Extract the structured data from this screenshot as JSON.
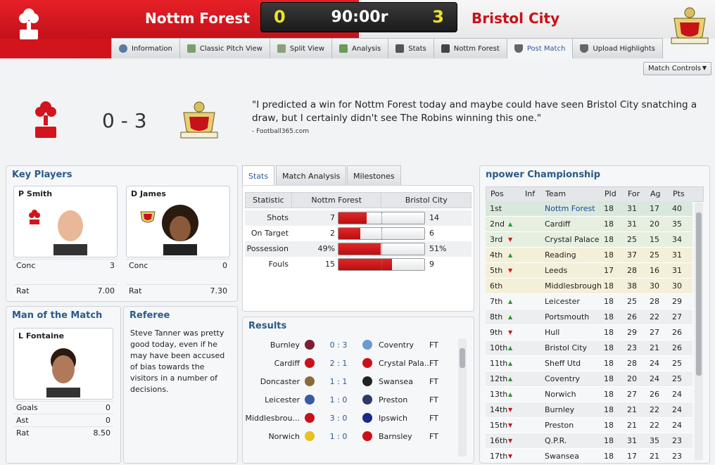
{
  "header": {
    "home_team": "Nottm Forest",
    "away_team": "Bristol City",
    "home_score": "0",
    "away_score": "3",
    "clock": "90:00r"
  },
  "tabs": [
    {
      "label": "Information",
      "icon": "info-icon"
    },
    {
      "label": "Classic Pitch View",
      "icon": "pitch-icon"
    },
    {
      "label": "Split View",
      "icon": "split-icon"
    },
    {
      "label": "Analysis",
      "icon": "analysis-icon"
    },
    {
      "label": "Stats",
      "icon": "stats-icon"
    },
    {
      "label": "Nottm Forest",
      "icon": "team-icon"
    },
    {
      "label": "Post Match",
      "icon": "shield-icon",
      "active": true
    },
    {
      "label": "Upload Highlights",
      "icon": "shield-icon"
    }
  ],
  "match_controls": "Match Controls",
  "summary": {
    "score": "0 - 3",
    "quote": "\"I predicted a win for Nottm Forest today and maybe could have seen Bristol City snatching a draw, but I certainly didn't see The Robins winning this one.\"",
    "source": "- Football365.com"
  },
  "key_players": {
    "title": "Key Players",
    "players": [
      {
        "name": "P Smith",
        "stat1_label": "Conc",
        "stat1": "3",
        "rat_label": "Rat",
        "rat": "7.00"
      },
      {
        "name": "D James",
        "stat1_label": "Conc",
        "stat1": "0",
        "rat_label": "Rat",
        "rat": "7.30"
      }
    ]
  },
  "motm": {
    "title": "Man of the Match",
    "name": "L Fontaine",
    "rows": [
      {
        "label": "Goals",
        "value": "0"
      },
      {
        "label": "Ast",
        "value": "0"
      },
      {
        "label": "Rat",
        "value": "8.50"
      }
    ]
  },
  "referee": {
    "title": "Referee",
    "text": "Steve Tanner was pretty good today, even if he may have been accused of bias towards the visitors in a number of decisions."
  },
  "stats_tabs": [
    "Stats",
    "Match Analysis",
    "Milestones"
  ],
  "stats": {
    "headers": [
      "Statistic",
      "Nottm Forest",
      "Bristol City"
    ],
    "rows": [
      {
        "label": "Shots",
        "home": "7",
        "away": "14",
        "fill": 0.33
      },
      {
        "label": "On Target",
        "home": "2",
        "away": "6",
        "fill": 0.25
      },
      {
        "label": "Possession",
        "home": "49%",
        "away": "51%",
        "fill": 0.49
      },
      {
        "label": "Fouls",
        "home": "15",
        "away": "9",
        "fill": 0.62
      }
    ]
  },
  "results": {
    "title": "Results",
    "rows": [
      {
        "home": "Burnley",
        "score": "0 : 3",
        "away": "Coventry",
        "status": "FT"
      },
      {
        "home": "Cardiff",
        "score": "2 : 1",
        "away": "Crystal Pala...",
        "status": "FT"
      },
      {
        "home": "Doncaster",
        "score": "1 : 1",
        "away": "Swansea",
        "status": "FT"
      },
      {
        "home": "Leicester",
        "score": "1 : 0",
        "away": "Preston",
        "status": "FT"
      },
      {
        "home": "Middlesbrou...",
        "score": "3 : 0",
        "away": "Ipswich",
        "status": "FT"
      },
      {
        "home": "Norwich",
        "score": "1 : 0",
        "away": "Barnsley",
        "status": "FT"
      }
    ]
  },
  "league": {
    "title": "npower Championship",
    "headers": [
      "Pos",
      "Inf",
      "Team",
      "Pld",
      "For",
      "Ag",
      "Pts"
    ],
    "rows": [
      {
        "pos": "1st",
        "mv": "",
        "team": "Nottm Forest",
        "pld": "18",
        "for": "31",
        "ag": "17",
        "pts": "40",
        "bg": "#d9e8dc"
      },
      {
        "pos": "2nd",
        "mv": "up",
        "team": "Cardiff",
        "pld": "18",
        "for": "31",
        "ag": "20",
        "pts": "35",
        "bg": "#e6efe0"
      },
      {
        "pos": "3rd",
        "mv": "dn",
        "team": "Crystal Palace",
        "pld": "18",
        "for": "25",
        "ag": "15",
        "pts": "34",
        "bg": "#e6efe0"
      },
      {
        "pos": "4th",
        "mv": "up",
        "team": "Reading",
        "pld": "18",
        "for": "37",
        "ag": "25",
        "pts": "31",
        "bg": "#f4efd8"
      },
      {
        "pos": "5th",
        "mv": "dn",
        "team": "Leeds",
        "pld": "17",
        "for": "28",
        "ag": "16",
        "pts": "31",
        "bg": "#f4efd8"
      },
      {
        "pos": "6th",
        "mv": "",
        "team": "Middlesbrough",
        "pld": "18",
        "for": "38",
        "ag": "30",
        "pts": "30",
        "bg": "#f4efd8"
      },
      {
        "pos": "7th",
        "mv": "up",
        "team": "Leicester",
        "pld": "18",
        "for": "25",
        "ag": "28",
        "pts": "29",
        "bg": "#f6f7f8"
      },
      {
        "pos": "8th",
        "mv": "up",
        "team": "Portsmouth",
        "pld": "18",
        "for": "26",
        "ag": "22",
        "pts": "27",
        "bg": "#eceef0"
      },
      {
        "pos": "9th",
        "mv": "dn",
        "team": "Hull",
        "pld": "18",
        "for": "29",
        "ag": "27",
        "pts": "26",
        "bg": "#f6f7f8"
      },
      {
        "pos": "10th",
        "mv": "up",
        "team": "Bristol City",
        "pld": "18",
        "for": "23",
        "ag": "21",
        "pts": "26",
        "bg": "#eceef0"
      },
      {
        "pos": "11th",
        "mv": "up",
        "team": "Sheff Utd",
        "pld": "18",
        "for": "28",
        "ag": "24",
        "pts": "25",
        "bg": "#f6f7f8"
      },
      {
        "pos": "12th",
        "mv": "up",
        "team": "Coventry",
        "pld": "18",
        "for": "20",
        "ag": "24",
        "pts": "25",
        "bg": "#eceef0"
      },
      {
        "pos": "13th",
        "mv": "up",
        "team": "Norwich",
        "pld": "18",
        "for": "27",
        "ag": "26",
        "pts": "24",
        "bg": "#f6f7f8"
      },
      {
        "pos": "14th",
        "mv": "dn",
        "team": "Burnley",
        "pld": "18",
        "for": "21",
        "ag": "22",
        "pts": "24",
        "bg": "#eceef0"
      },
      {
        "pos": "15th",
        "mv": "dn",
        "team": "Preston",
        "pld": "18",
        "for": "21",
        "ag": "22",
        "pts": "24",
        "bg": "#f6f7f8"
      },
      {
        "pos": "16th",
        "mv": "dn",
        "team": "Q.P.R.",
        "pld": "18",
        "for": "31",
        "ag": "35",
        "pts": "23",
        "bg": "#eceef0"
      },
      {
        "pos": "17th",
        "mv": "dn",
        "team": "Swansea",
        "pld": "18",
        "for": "17",
        "ag": "21",
        "pts": "23",
        "bg": "#f6f7f8"
      }
    ]
  }
}
